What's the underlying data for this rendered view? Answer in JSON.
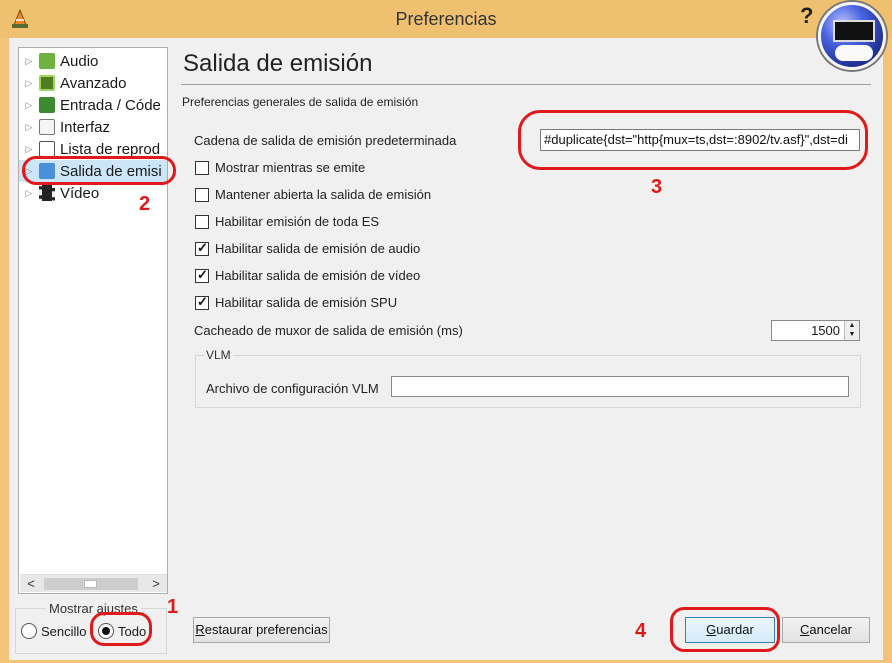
{
  "window": {
    "title": "Preferencias",
    "help_label": "?"
  },
  "tree": {
    "items": [
      {
        "label": "Audio"
      },
      {
        "label": "Avanzado"
      },
      {
        "label": "Entrada / Códe"
      },
      {
        "label": "Interfaz"
      },
      {
        "label": "Lista de reprod"
      },
      {
        "label": "Salida de emisi"
      },
      {
        "label": "Vídeo"
      }
    ],
    "arrow": "▷",
    "scroll_left": "<",
    "scroll_right": ">"
  },
  "mode": {
    "title": "Mostrar ajustes",
    "simple_label": "Sencillo",
    "all_label": "Todo",
    "selected": "Todo"
  },
  "panel": {
    "title": "Salida de emisión",
    "subtitle": "Preferencias generales de salida de emisión",
    "chain_label": "Cadena de salida de emisión predeterminada",
    "chain_value": "#duplicate{dst=\"http{mux=ts,dst=:8902/tv.asf}\",dst=di",
    "checkboxes": [
      {
        "label": "Mostrar mientras se emite",
        "checked": false
      },
      {
        "label": "Mantener abierta la salida de emisión",
        "checked": false
      },
      {
        "label": "Habilitar emisión de toda ES",
        "checked": false
      },
      {
        "label": "Habilitar salida de emisión de audio",
        "checked": true
      },
      {
        "label": "Habilitar salida de emisión de vídeo",
        "checked": true
      },
      {
        "label": "Habilitar salida de emisión SPU",
        "checked": true
      }
    ],
    "caching_label": "Cacheado de muxor de salida de emisión (ms)",
    "caching_value": "1500",
    "vlm_title": "VLM",
    "vlm_label": "Archivo de configuración VLM",
    "vlm_value": ""
  },
  "buttons": {
    "reset_prefix": "R",
    "reset_rest": "estaurar preferencias",
    "save_prefix": "G",
    "save_rest": "uardar",
    "cancel_prefix": "C",
    "cancel_rest": "ancelar"
  },
  "annotations": [
    "1",
    "2",
    "3",
    "4"
  ],
  "colors": {
    "callout": "#e01a1a",
    "titlebar": "#efc06f",
    "window_bg": "#f0f0f0"
  }
}
